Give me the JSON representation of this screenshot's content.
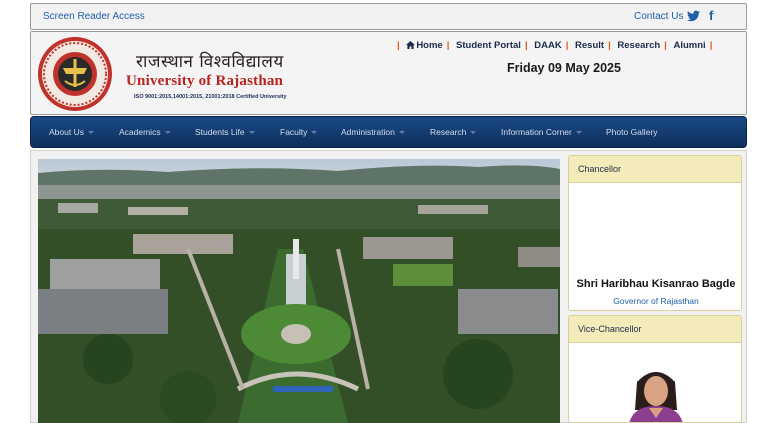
{
  "topbar": {
    "screen_reader": "Screen Reader Access",
    "contact": "Contact Us",
    "facebook_glyph": "f",
    "icons": [
      "twitter-icon",
      "facebook-icon"
    ]
  },
  "header": {
    "title_hindi": "राजस्थान विश्वविद्यालय",
    "title_english": "University of Rajasthan",
    "iso_text": "ISO 9001:2015,14001:2015, 21001:2018 Certified University",
    "quick_links": [
      {
        "label": "Home",
        "icon": "home-icon"
      },
      {
        "label": "Student Portal"
      },
      {
        "label": "DAAK"
      },
      {
        "label": "Result"
      },
      {
        "label": "Research"
      },
      {
        "label": "Alumni"
      }
    ],
    "date": "Friday 09 May 2025"
  },
  "nav": {
    "items": [
      {
        "label": "About Us",
        "has_dropdown": true
      },
      {
        "label": "Academics",
        "has_dropdown": true
      },
      {
        "label": "Students Life",
        "has_dropdown": true
      },
      {
        "label": "Faculty",
        "has_dropdown": true
      },
      {
        "label": "Administration",
        "has_dropdown": true
      },
      {
        "label": "Research",
        "has_dropdown": true
      },
      {
        "label": "Information Corner",
        "has_dropdown": true
      },
      {
        "label": "Photo Gallery",
        "has_dropdown": false
      }
    ]
  },
  "sidebar": {
    "chancellor": {
      "heading": "Chancellor",
      "name": "Shri Haribhau Kisanrao Bagde",
      "designation": "Governor of Rajasthan"
    },
    "vice_chancellor": {
      "heading": "Vice-Chancellor"
    }
  },
  "colors": {
    "nav_bg": "#0d2f5c",
    "brand_red": "#b8231e",
    "link_blue": "#1f5fa8",
    "side_header": "#f3ebb9"
  }
}
